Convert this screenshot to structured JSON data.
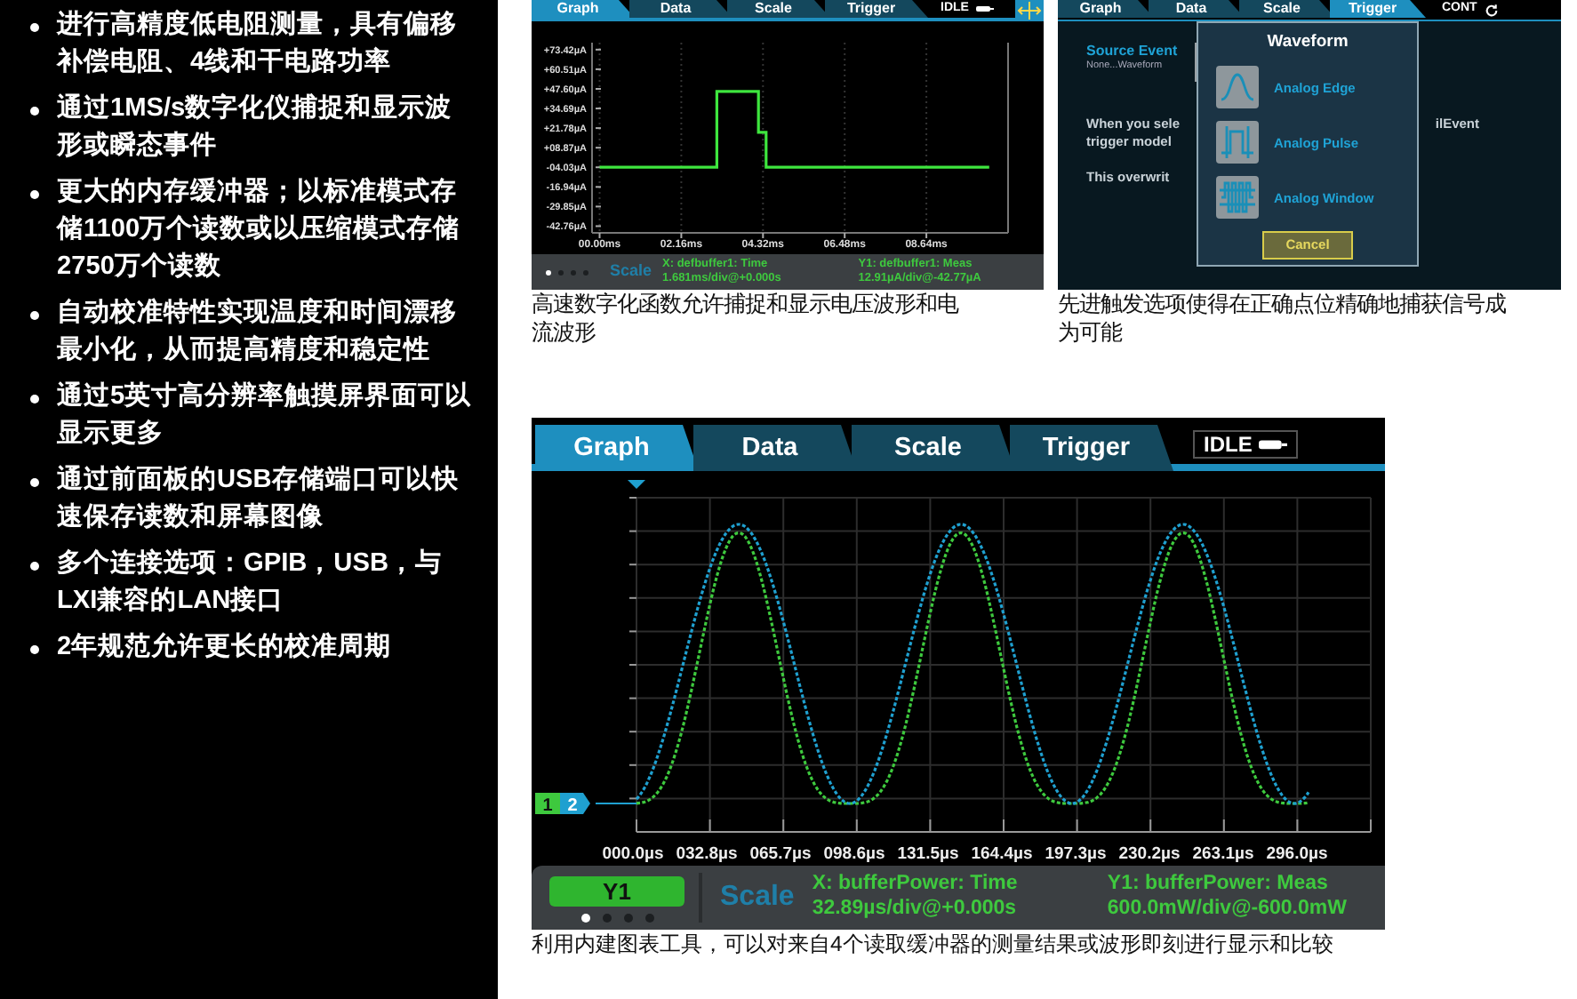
{
  "features": [
    "进行高精度低电阻测量，具有偏移补偿电阻、4线和干电路功率",
    "通过1MS/s数字化仪捕捉和显示波形或瞬态事件",
    "更大的内存缓冲器；以标准模式存储1100万个读数或以压缩模式存储2750万个读数",
    "自动校准特性实现温度和时间漂移最小化，从而提高精度和稳定性",
    "通过5英寸高分辨率触摸屏界面可以显示更多",
    "通过前面板的USB存储端口可以快速保存读数和屏幕图像",
    "多个连接选项：GPIB，USB，与LXI兼容的LAN接口",
    "2年规范允许更长的校准周期"
  ],
  "digitizer_screen": {
    "tabs": [
      {
        "label": "Graph",
        "selected": true
      },
      {
        "label": "Data",
        "selected": false
      },
      {
        "label": "Scale",
        "selected": false
      },
      {
        "label": "Trigger",
        "selected": false
      }
    ],
    "status": "IDLE",
    "chart_data": {
      "type": "line",
      "x": [
        0,
        3.1,
        3.1,
        4.2,
        4.2,
        4.4,
        4.4,
        10.3
      ],
      "series": [
        {
          "color": "#3ee63e",
          "values": [
            -4,
            -4,
            46,
            46,
            19,
            19,
            -4,
            -4
          ]
        }
      ],
      "xlim": [
        -0.2,
        10.8
      ],
      "ylim": [
        -46,
        78
      ],
      "grid": true,
      "xticks": [
        {
          "value": 0,
          "label": "00.00ms"
        },
        {
          "value": 2.16,
          "label": "02.16ms"
        },
        {
          "value": 4.32,
          "label": "04.32ms"
        },
        {
          "value": 6.48,
          "label": "06.48ms"
        },
        {
          "value": 8.64,
          "label": "08.64ms"
        }
      ],
      "yticks": [
        {
          "value": 73.42,
          "label": "+73.42µA"
        },
        {
          "value": 60.51,
          "label": "+60.51µA"
        },
        {
          "value": 47.6,
          "label": "+47.60µA"
        },
        {
          "value": 34.69,
          "label": "+34.69µA"
        },
        {
          "value": 21.78,
          "label": "+21.78µA"
        },
        {
          "value": 8.87,
          "label": "+08.87µA"
        },
        {
          "value": -4.03,
          "label": "-04.03µA"
        },
        {
          "value": -16.94,
          "label": "-16.94µA"
        },
        {
          "value": -29.85,
          "label": "-29.85µA"
        },
        {
          "value": -42.76,
          "label": "-42.76µA"
        }
      ]
    },
    "page_dots": [
      {
        "selected": true
      },
      {
        "selected": false
      },
      {
        "selected": false
      },
      {
        "selected": false
      }
    ],
    "panel_label": "Scale",
    "x_axis_info": "X: defbuffer1: Time",
    "x_axis_scale": "1.681ms/div@+0.000s",
    "y_axis_info": "Y1: defbuffer1: Meas",
    "y_axis_scale": "12.91µA/div@-42.77µA"
  },
  "digitizer_caption": "高速数字化函数允许捕捉和显示电压波形和电流波形",
  "trigger_screen": {
    "tabs": [
      {
        "label": "Graph",
        "selected": false
      },
      {
        "label": "Data",
        "selected": false
      },
      {
        "label": "Scale",
        "selected": false
      },
      {
        "label": "Trigger",
        "selected": true
      }
    ],
    "status": "CONT",
    "source_event": {
      "label": "Source Event",
      "value": "None...Waveform"
    },
    "body_lines": [
      {
        "left": "When you sele",
        "right": "ilEvent"
      },
      {
        "left": "trigger model"
      },
      {
        "left": "This overwrit"
      }
    ],
    "dialog": {
      "title": "Waveform",
      "options": [
        {
          "kind": "edge",
          "label": "Analog Edge"
        },
        {
          "kind": "pulse",
          "label": "Analog Pulse"
        },
        {
          "kind": "window",
          "label": "Analog Window"
        }
      ],
      "cancel": "Cancel"
    }
  },
  "trigger_caption": "先进触发选项使得在正确点位精确地捕获信号成为可能",
  "graph_screen": {
    "tabs": [
      {
        "label": "Graph",
        "selected": true
      },
      {
        "label": "Data",
        "selected": false
      },
      {
        "label": "Scale",
        "selected": false
      },
      {
        "label": "Trigger",
        "selected": false
      }
    ],
    "status": "IDLE",
    "traces": [
      {
        "label": "1",
        "color": "#3ec93e"
      },
      {
        "label": "2",
        "color": "#1fa0d0"
      }
    ],
    "x_axis_labels": [
      "000.0µs",
      "032.8µs",
      "065.7µs",
      "098.6µs",
      "131.5µs",
      "164.4µs",
      "197.3µs",
      "230.2µs",
      "263.1µs",
      "296.0µs"
    ],
    "trace_button": "Y1",
    "page_dots": [
      {
        "selected": true
      },
      {
        "selected": false
      },
      {
        "selected": false
      },
      {
        "selected": false
      }
    ],
    "panel_label": "Scale",
    "x_axis_info": "X: bufferPower: Time",
    "x_axis_scale": "32.89µs/div@+0.000s",
    "y_axis_info": "Y1: bufferPower: Meas",
    "y_axis_scale": "600.0mW/div@-600.0mW"
  },
  "graph_caption": "利用内建图表工具，可以对来自4个读取缓冲器的测量结果或波形即刻进行显示和比较"
}
